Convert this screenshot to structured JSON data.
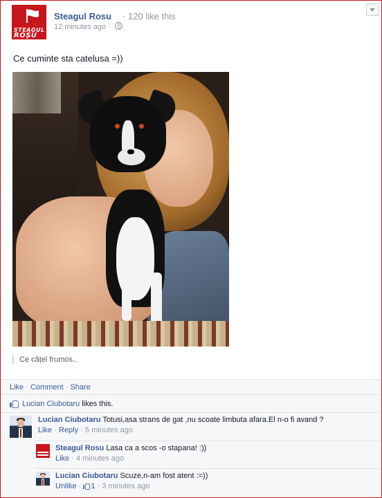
{
  "post": {
    "page_name": "Steagul Rosu",
    "likes_summary": "120 like this",
    "separator": "·",
    "time": "12 minutes ago",
    "time_sep": "·",
    "logo_top": "STEAGUL",
    "logo_bottom": "ROȘU",
    "text": "Ce cuminte sta catelusa =))",
    "photo_caption": "Ce cățel frumos..",
    "colors": {
      "accent_red": "#c8161d",
      "link_blue": "#3b5998",
      "muted": "#9197a3"
    }
  },
  "actions": {
    "like": "Like",
    "sep1": "·",
    "comment": "Comment",
    "sep2": "·",
    "share": "Share"
  },
  "likes": {
    "name": "Lucian Ciubotaru",
    "suffix": "likes this."
  },
  "comments": [
    {
      "author": "Lucian Ciubotaru",
      "text": "Totusi,asa strans de gat ,nu scoate limbuta afara.El n-o fi avand ?",
      "like": "Like",
      "reply": "Reply",
      "sep": "·",
      "time": "5 minutes ago"
    }
  ],
  "replies": [
    {
      "author": "Steagul Rosu",
      "text": "Lasa ca a scos -o stapana! :))",
      "like": "Like",
      "sep": "·",
      "time": "4 minutes ago"
    },
    {
      "author": "Lucian Ciubotaru",
      "text": "Scuze,n-am fost atent :=))",
      "unlike": "Unlike",
      "sep": "·",
      "like_count": "1",
      "time": "3 minutes ago"
    }
  ]
}
